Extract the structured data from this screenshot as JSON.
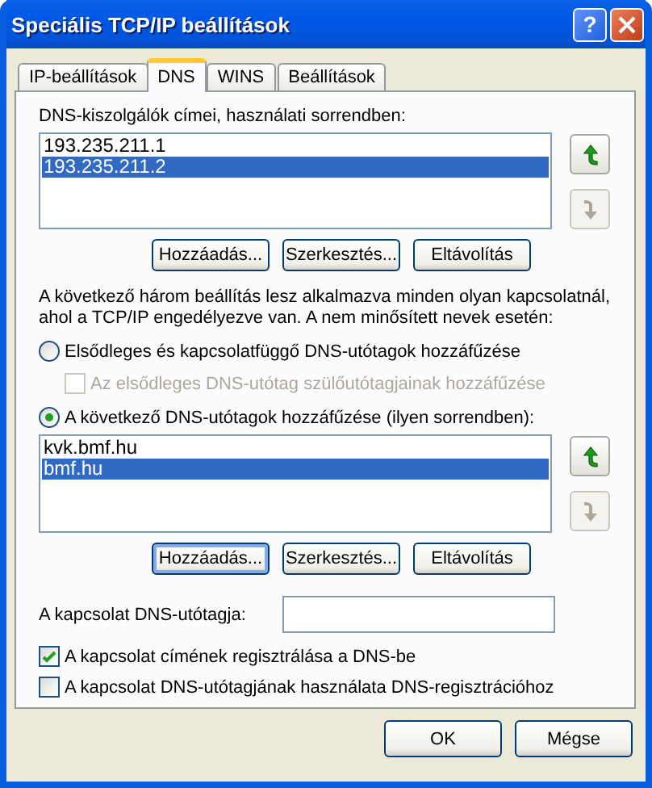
{
  "window": {
    "title": "Speciális TCP/IP beállítások",
    "help_button": "?"
  },
  "tabs": [
    {
      "label": "IP-beállítások",
      "selected": false
    },
    {
      "label": "DNS",
      "selected": true
    },
    {
      "label": "WINS",
      "selected": false
    },
    {
      "label": "Beállítások",
      "selected": false
    }
  ],
  "dns_servers": {
    "label": "DNS-kiszolgálók címei, használati sorrendben:",
    "items": [
      {
        "text": "193.235.211.1",
        "selected": false
      },
      {
        "text": "193.235.211.2",
        "selected": true
      }
    ],
    "move_up": {
      "disabled": false
    },
    "move_down": {
      "disabled": true
    },
    "buttons": [
      {
        "label": "Hozzáadás...",
        "focused": false
      },
      {
        "label": "Szerkesztés...",
        "focused": false
      },
      {
        "label": "Eltávolítás",
        "focused": false
      }
    ]
  },
  "suffix_settings": {
    "description": "A következő három beállítás lesz alkalmazva minden olyan kapcsolatnál, ahol a TCP/IP engedélyezve van. A nem minősített nevek esetén:",
    "options": [
      {
        "label": "Elsődleges és kapcsolatfüggő DNS-utótagok hozzáfűzése",
        "selected": false,
        "children": [
          {
            "label": "Az elsődleges DNS-utótag szülőutótagjainak hozzáfűzése",
            "checked": false,
            "disabled": true
          }
        ]
      },
      {
        "label": "A következő DNS-utótagok hozzáfűzése (ilyen sorrendben):",
        "selected": true
      }
    ],
    "items": [
      {
        "text": "kvk.bmf.hu",
        "selected": false
      },
      {
        "text": "bmf.hu",
        "selected": true
      }
    ],
    "move_up": {
      "disabled": false
    },
    "move_down": {
      "disabled": true
    },
    "buttons": [
      {
        "label": "Hozzáadás...",
        "focused": true
      },
      {
        "label": "Szerkesztés...",
        "focused": false
      },
      {
        "label": "Eltávolítás",
        "focused": false
      }
    ]
  },
  "connection_suffix": {
    "label": "A kapcsolat DNS-utótagja:"
  },
  "checkboxes": [
    {
      "label": "A kapcsolat címének regisztrálása a DNS-be",
      "checked": true
    },
    {
      "label": "A kapcsolat DNS-utótagjának használata DNS-regisztrációhoz",
      "checked": false
    }
  ],
  "dialog_buttons": [
    {
      "label": "OK"
    },
    {
      "label": "Mégse"
    }
  ]
}
